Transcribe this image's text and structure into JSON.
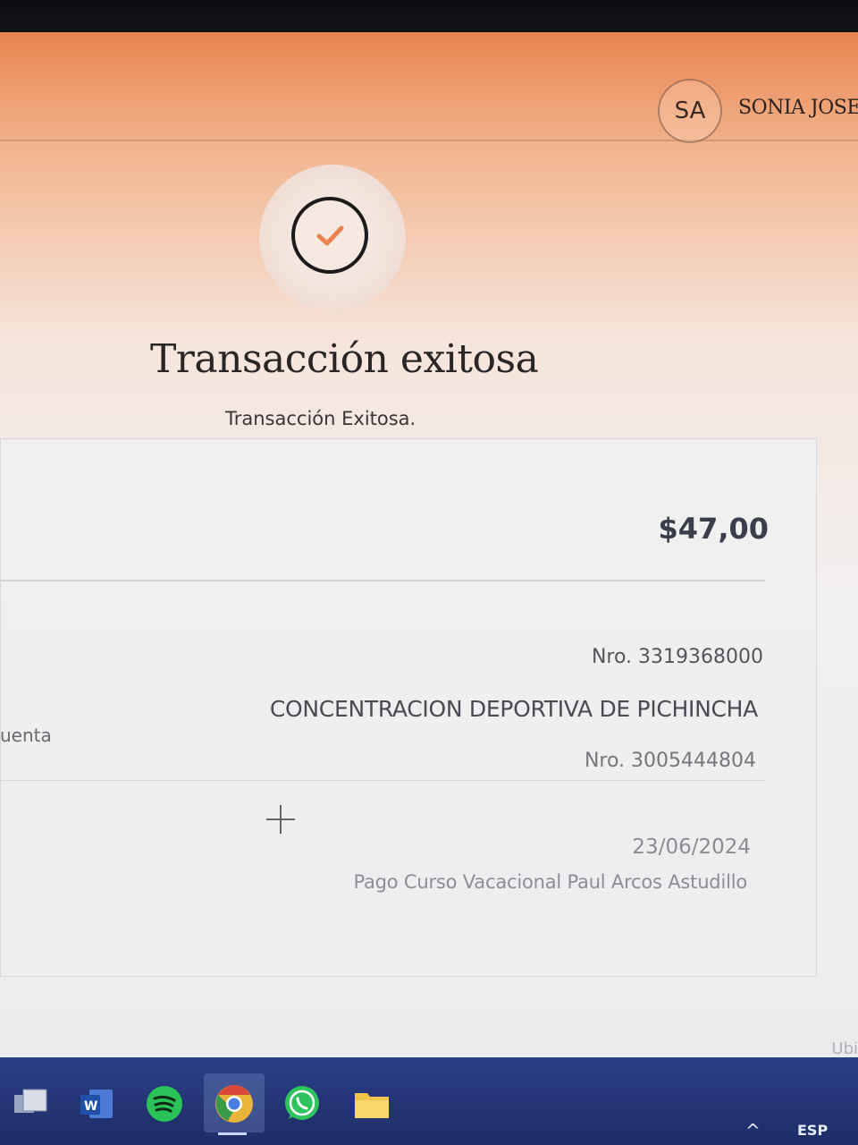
{
  "header": {
    "avatar_initials": "SA",
    "user_name": "SONIA JOSE"
  },
  "status": {
    "icon": "check-icon",
    "title": "Transacción exitosa",
    "subtitle": "Transacción Exitosa."
  },
  "transaction": {
    "amount": "$47,00",
    "origin_account": "Nro. 3319368000",
    "account_label": "uenta",
    "beneficiary_name": "CONCENTRACION DEPORTIVA DE PICHINCHA",
    "beneficiary_account": "Nro. 3005444804",
    "date": "23/06/2024",
    "description": "Pago Curso Vacacional Paul Arcos Astudillo"
  },
  "footer": {
    "corner_text": "Ubi"
  },
  "taskbar": {
    "apps": [
      {
        "icon": "task-view-icon"
      },
      {
        "icon": "word-icon"
      },
      {
        "icon": "spotify-icon"
      },
      {
        "icon": "chrome-icon"
      },
      {
        "icon": "whatsapp-icon"
      },
      {
        "icon": "file-explorer-icon"
      }
    ],
    "tray_chevron": "^",
    "language": "ESP"
  },
  "colors": {
    "accent": "#e9844f",
    "taskbar": "#2b3f86"
  }
}
